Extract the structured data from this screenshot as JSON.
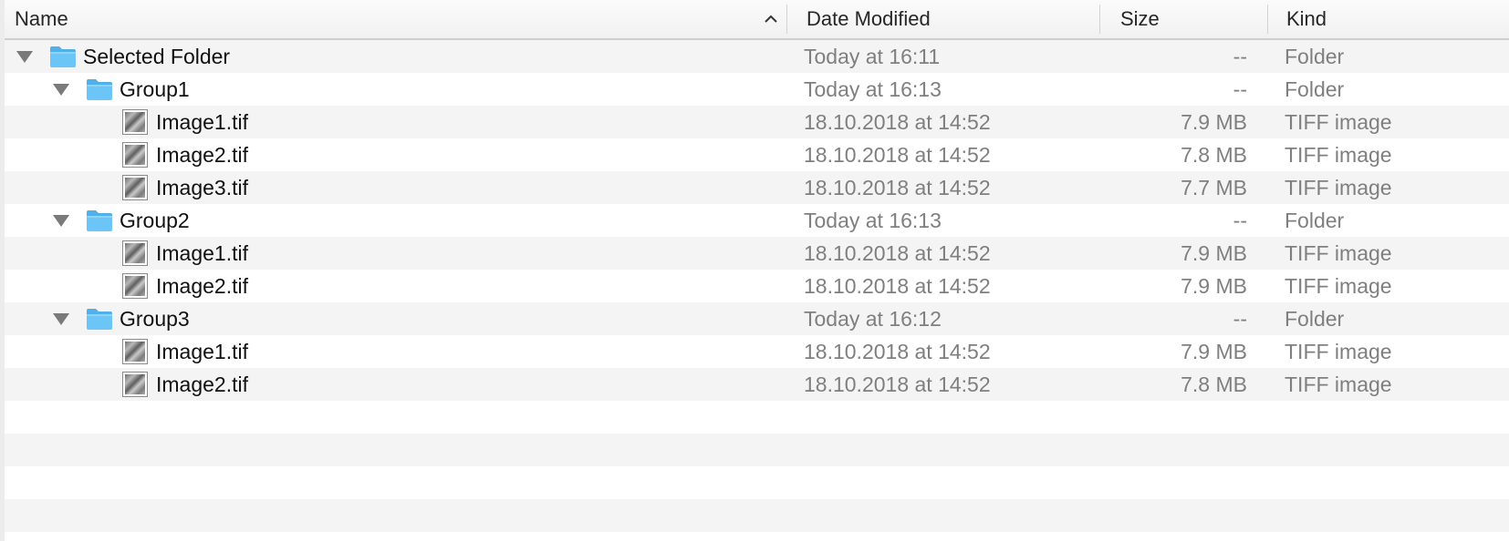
{
  "columns": {
    "name": "Name",
    "date": "Date Modified",
    "size": "Size",
    "kind": "Kind"
  },
  "sort": {
    "column": "name",
    "direction": "ascending",
    "icon": "chevron-up-icon"
  },
  "colors": {
    "folder_blue": "#6cc5f7",
    "row_alt": "#f4f4f4",
    "meta_text": "#7f7f7f"
  },
  "rows": [
    {
      "type": "folder",
      "level": 0,
      "expanded": true,
      "name": "Selected Folder",
      "date": "Today at 16:11",
      "size": "--",
      "kind": "Folder"
    },
    {
      "type": "folder",
      "level": 1,
      "expanded": true,
      "name": "Group1",
      "date": "Today at 16:13",
      "size": "--",
      "kind": "Folder"
    },
    {
      "type": "file",
      "level": 2,
      "name": "Image1.tif",
      "date": "18.10.2018 at 14:52",
      "size": "7.9 MB",
      "kind": "TIFF image"
    },
    {
      "type": "file",
      "level": 2,
      "name": "Image2.tif",
      "date": "18.10.2018 at 14:52",
      "size": "7.8 MB",
      "kind": "TIFF image"
    },
    {
      "type": "file",
      "level": 2,
      "name": "Image3.tif",
      "date": "18.10.2018 at 14:52",
      "size": "7.7 MB",
      "kind": "TIFF image"
    },
    {
      "type": "folder",
      "level": 1,
      "expanded": true,
      "name": "Group2",
      "date": "Today at 16:13",
      "size": "--",
      "kind": "Folder"
    },
    {
      "type": "file",
      "level": 2,
      "name": "Image1.tif",
      "date": "18.10.2018 at 14:52",
      "size": "7.9 MB",
      "kind": "TIFF image"
    },
    {
      "type": "file",
      "level": 2,
      "name": "Image2.tif",
      "date": "18.10.2018 at 14:52",
      "size": "7.9 MB",
      "kind": "TIFF image"
    },
    {
      "type": "folder",
      "level": 1,
      "expanded": true,
      "name": "Group3",
      "date": "Today at 16:12",
      "size": "--",
      "kind": "Folder"
    },
    {
      "type": "file",
      "level": 2,
      "name": "Image1.tif",
      "date": "18.10.2018 at 14:52",
      "size": "7.9 MB",
      "kind": "TIFF image"
    },
    {
      "type": "file",
      "level": 2,
      "name": "Image2.tif",
      "date": "18.10.2018 at 14:52",
      "size": "7.8 MB",
      "kind": "TIFF image"
    }
  ]
}
